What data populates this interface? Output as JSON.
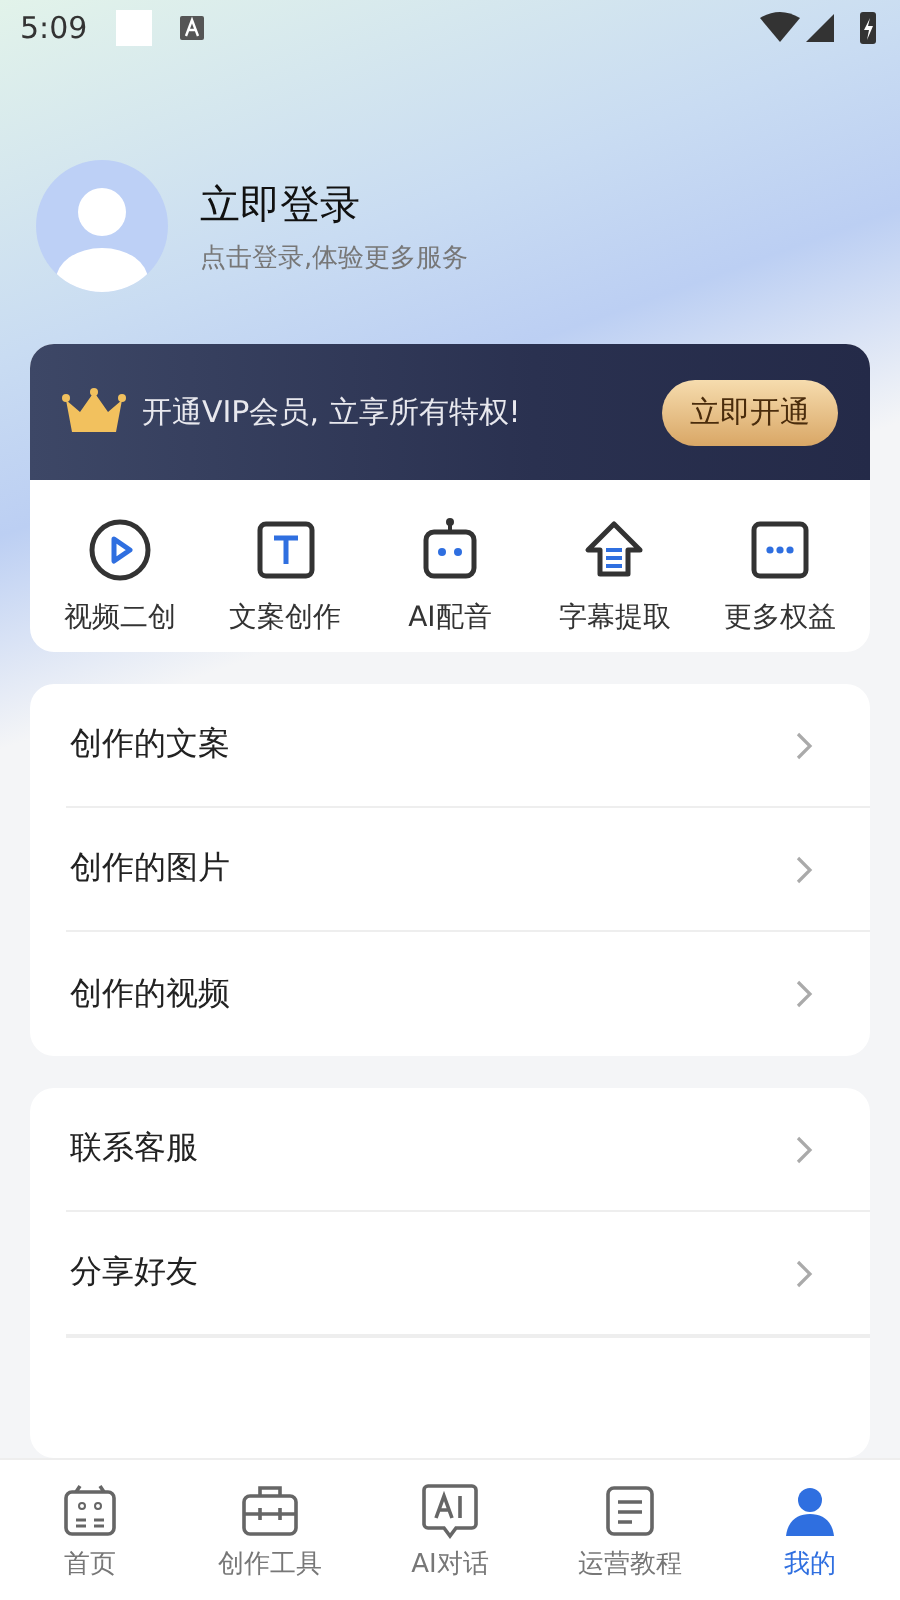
{
  "status_bar": {
    "time": "5:09"
  },
  "profile": {
    "title": "立即登录",
    "subtitle": "点击登录,体验更多服务"
  },
  "vip": {
    "text": "开通VIP会员, 立享所有特权!",
    "button": "立即开通"
  },
  "features": [
    {
      "kind": "video",
      "label": "视频二创"
    },
    {
      "kind": "text",
      "label": "文案创作"
    },
    {
      "kind": "robot",
      "label": "AI配音"
    },
    {
      "kind": "extract",
      "label": "字幕提取"
    },
    {
      "kind": "more",
      "label": "更多权益"
    }
  ],
  "menu_groups": [
    {
      "items": [
        {
          "label": "创作的文案"
        },
        {
          "label": "创作的图片"
        },
        {
          "label": "创作的视频"
        }
      ]
    },
    {
      "items": [
        {
          "label": "联系客服"
        },
        {
          "label": "分享好友"
        }
      ]
    }
  ],
  "tab_bar": [
    {
      "kind": "home",
      "label": "首页",
      "selected": false
    },
    {
      "kind": "tools",
      "label": "创作工具",
      "selected": false
    },
    {
      "kind": "ai",
      "label": "AI对话",
      "selected": false
    },
    {
      "kind": "book",
      "label": "运营教程",
      "selected": false
    },
    {
      "kind": "user",
      "label": "我的",
      "selected": true
    }
  ]
}
